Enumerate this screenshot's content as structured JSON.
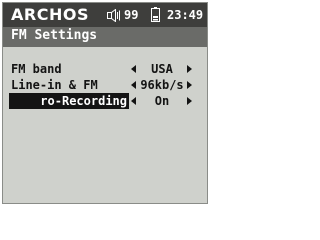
{
  "statusbar": {
    "brand": "ARCHOS",
    "volume": "99",
    "clock": "23:49",
    "icons": {
      "speaker": "speaker-icon",
      "battery": "battery-icon"
    }
  },
  "title": "FM Settings",
  "settings": [
    {
      "label": "FM band",
      "value": "USA",
      "selected": false
    },
    {
      "label": "Line-in & FM",
      "value": "96kb/s",
      "selected": false
    },
    {
      "label": "ro-Recording",
      "value": "On",
      "selected": true
    }
  ],
  "colors": {
    "screen_bg": "#cfd1cc",
    "statusbar_bg": "#3e3e3c",
    "titlebar_bg": "#6a6b68",
    "text": "#141414",
    "highlight_bg": "#141414",
    "highlight_text": "#ffffff"
  }
}
